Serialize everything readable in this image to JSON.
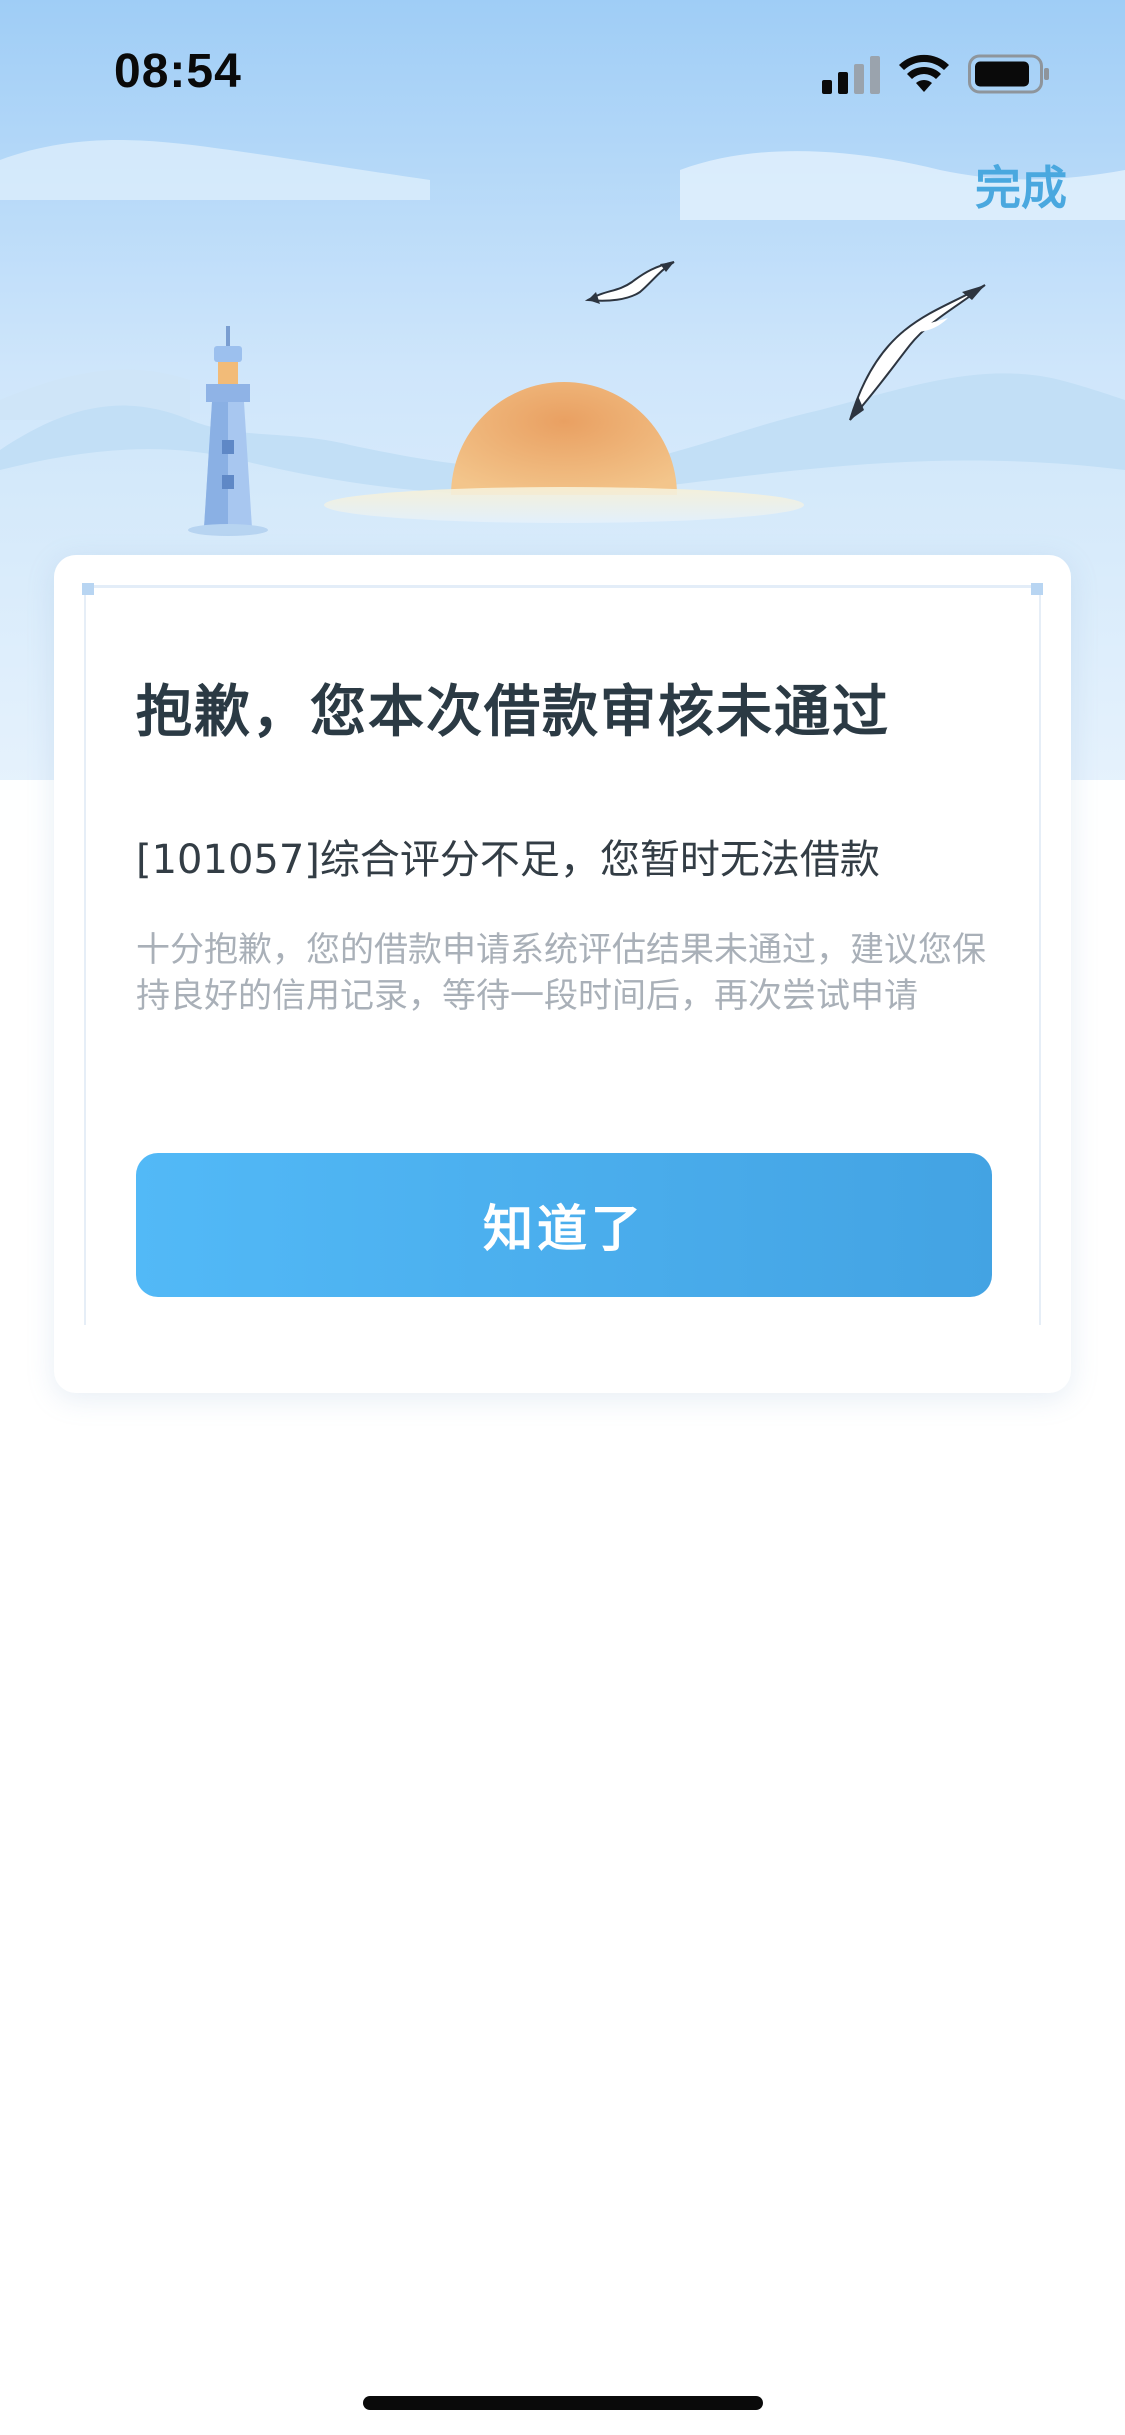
{
  "status_bar": {
    "time": "08:54"
  },
  "header": {
    "done_label": "完成",
    "illustration": "lighthouse-sunrise-seagulls"
  },
  "card": {
    "title": "抱歉，您本次借款审核未通过",
    "reason": "[101057]综合评分不足，您暂时无法借款",
    "detail": "十分抱歉，您的借款申请系统评估结果未通过，建议您保持良好的信用记录，等待一段时间后，再次尝试申请",
    "button_label": "知道了"
  },
  "colors": {
    "accent": "#4aa8df",
    "button_start": "#52b9f7",
    "button_end": "#43a3e3",
    "title": "#2b3a44",
    "muted": "#a9b0b8"
  }
}
